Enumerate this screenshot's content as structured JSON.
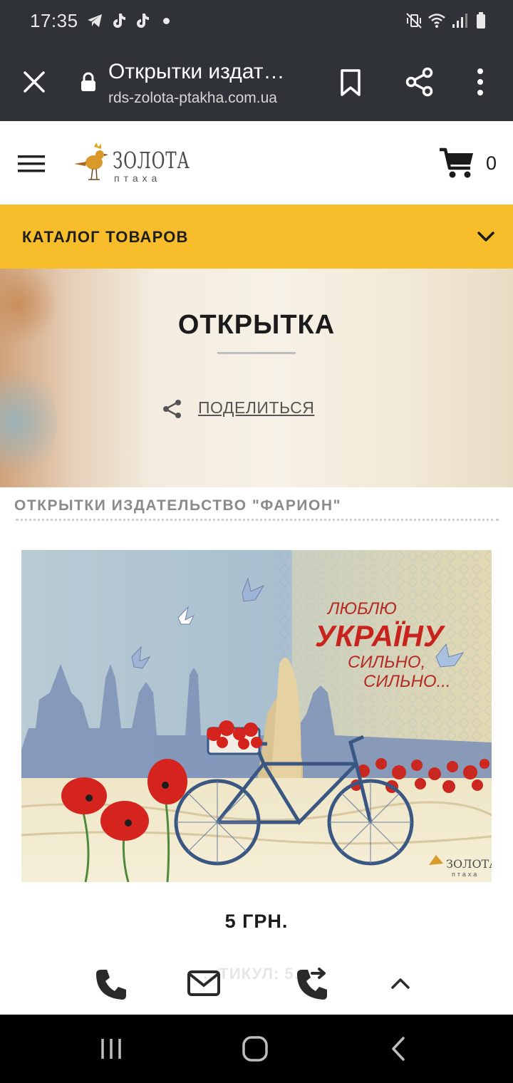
{
  "status_bar": {
    "time": "17:35",
    "left_icons": [
      "telegram-icon",
      "tiktok-icon",
      "tiktok-icon",
      "dot-icon"
    ],
    "right_icons": [
      "mute-vibrate-icon",
      "wifi-icon",
      "signal-icon",
      "battery-icon"
    ]
  },
  "browser": {
    "page_title": "Открытки издат…",
    "url": "rds-zolota-ptakha.com.ua"
  },
  "site": {
    "logo_main": "ЗОЛОТА",
    "logo_sub": "птаха",
    "cart_count": "0",
    "catalog_label": "КАТАЛОГ  ТОВАРОВ"
  },
  "hero": {
    "heading": "ОТКРЫТКА",
    "share_label": "ПОДЕЛИТЬСЯ"
  },
  "section": {
    "title": "ОТКРЫТКИ ИЗДАТЕЛЬСТВО \"ФАРИОН\""
  },
  "product": {
    "postcard_text_1": "ЛЮБЛЮ",
    "postcard_text_2": "УКРАЇНУ",
    "postcard_text_3": "СИЛЬНО,",
    "postcard_text_4": "СИЛЬНО...",
    "postcard_logo": "ЗОЛОТА",
    "postcard_logo_sub": "птаха",
    "price": "5 ГРН.",
    "article_partial": "…ТИКУЛ: 5…"
  },
  "colors": {
    "accent": "#f8bd2b",
    "browser_bar": "#2f3236",
    "poppy_red": "#d5231e"
  }
}
